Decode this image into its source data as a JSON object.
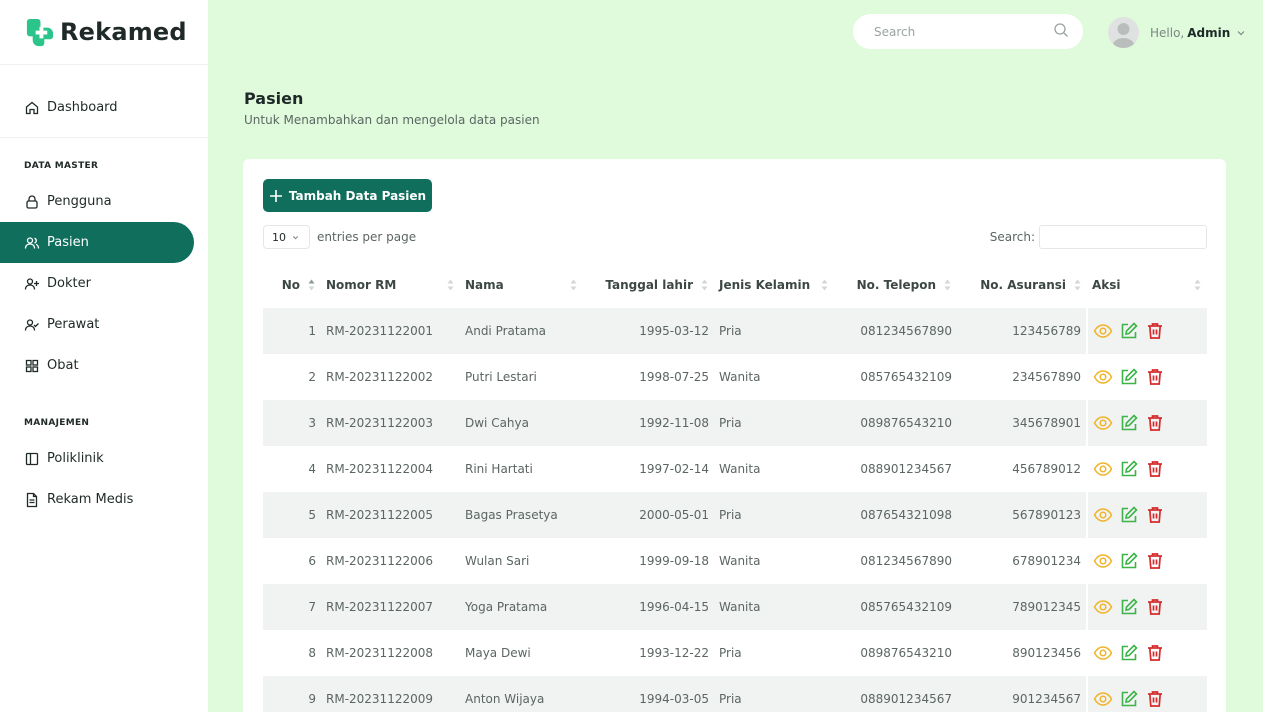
{
  "brand": {
    "name": "Rekamed",
    "color": "#0f6f5c"
  },
  "sidebar": {
    "dashboard": "Dashboard",
    "section_master": "DATA MASTER",
    "pengguna": "Pengguna",
    "pasien": "Pasien",
    "dokter": "Dokter",
    "perawat": "Perawat",
    "obat": "Obat",
    "section_manajemen": "MANAJEMEN",
    "poliklinik": "Poliklinik",
    "rekam_medis": "Rekam Medis",
    "active_item": "Pasien"
  },
  "header": {
    "search_placeholder": "Search",
    "greeting": "Hello,",
    "user_name": "Admin"
  },
  "page": {
    "title": "Pasien",
    "subtitle": "Untuk Menambahkan dan mengelola data pasien"
  },
  "toolbar": {
    "add_label": "Tambah Data Pasien",
    "page_size": "10",
    "entries_label": "entries per page",
    "search_label": "Search:"
  },
  "table": {
    "columns": [
      "No",
      "Nomor RM",
      "Nama",
      "Tanggal lahir",
      "Jenis Kelamin",
      "No. Telepon",
      "No. Asuransi",
      "Aksi"
    ],
    "rows": [
      {
        "no": "1",
        "rm": "RM-20231122001",
        "nama": "Andi Pratama",
        "lahir": "1995-03-12",
        "jk": "Pria",
        "telp": "081234567890",
        "asuransi": "123456789"
      },
      {
        "no": "2",
        "rm": "RM-20231122002",
        "nama": "Putri Lestari",
        "lahir": "1998-07-25",
        "jk": "Wanita",
        "telp": "085765432109",
        "asuransi": "234567890"
      },
      {
        "no": "3",
        "rm": "RM-20231122003",
        "nama": "Dwi Cahya",
        "lahir": "1992-11-08",
        "jk": "Pria",
        "telp": "089876543210",
        "asuransi": "345678901"
      },
      {
        "no": "4",
        "rm": "RM-20231122004",
        "nama": "Rini Hartati",
        "lahir": "1997-02-14",
        "jk": "Wanita",
        "telp": "088901234567",
        "asuransi": "456789012"
      },
      {
        "no": "5",
        "rm": "RM-20231122005",
        "nama": "Bagas Prasetya",
        "lahir": "2000-05-01",
        "jk": "Pria",
        "telp": "087654321098",
        "asuransi": "567890123"
      },
      {
        "no": "6",
        "rm": "RM-20231122006",
        "nama": "Wulan Sari",
        "lahir": "1999-09-18",
        "jk": "Wanita",
        "telp": "081234567890",
        "asuransi": "678901234"
      },
      {
        "no": "7",
        "rm": "RM-20231122007",
        "nama": "Yoga Pratama",
        "lahir": "1996-04-15",
        "jk": "Wanita",
        "telp": "085765432109",
        "asuransi": "789012345"
      },
      {
        "no": "8",
        "rm": "RM-20231122008",
        "nama": "Maya Dewi",
        "lahir": "1993-12-22",
        "jk": "Pria",
        "telp": "089876543210",
        "asuransi": "890123456"
      },
      {
        "no": "9",
        "rm": "RM-20231122009",
        "nama": "Anton Wijaya",
        "lahir": "1994-03-05",
        "jk": "Pria",
        "telp": "088901234567",
        "asuransi": "901234567"
      }
    ]
  },
  "colors": {
    "view": "#f0b429",
    "edit": "#3db34a",
    "delete": "#d62b2b",
    "background": "#e0fbdc"
  },
  "icons": [
    "home-icon",
    "lock-icon",
    "users-icon",
    "user-plus-icon",
    "user-check-icon",
    "grid-icon",
    "columns-icon",
    "file-text-icon",
    "search-icon",
    "chevron-down-icon",
    "plus-icon",
    "eye-icon",
    "edit-icon",
    "trash-icon"
  ]
}
